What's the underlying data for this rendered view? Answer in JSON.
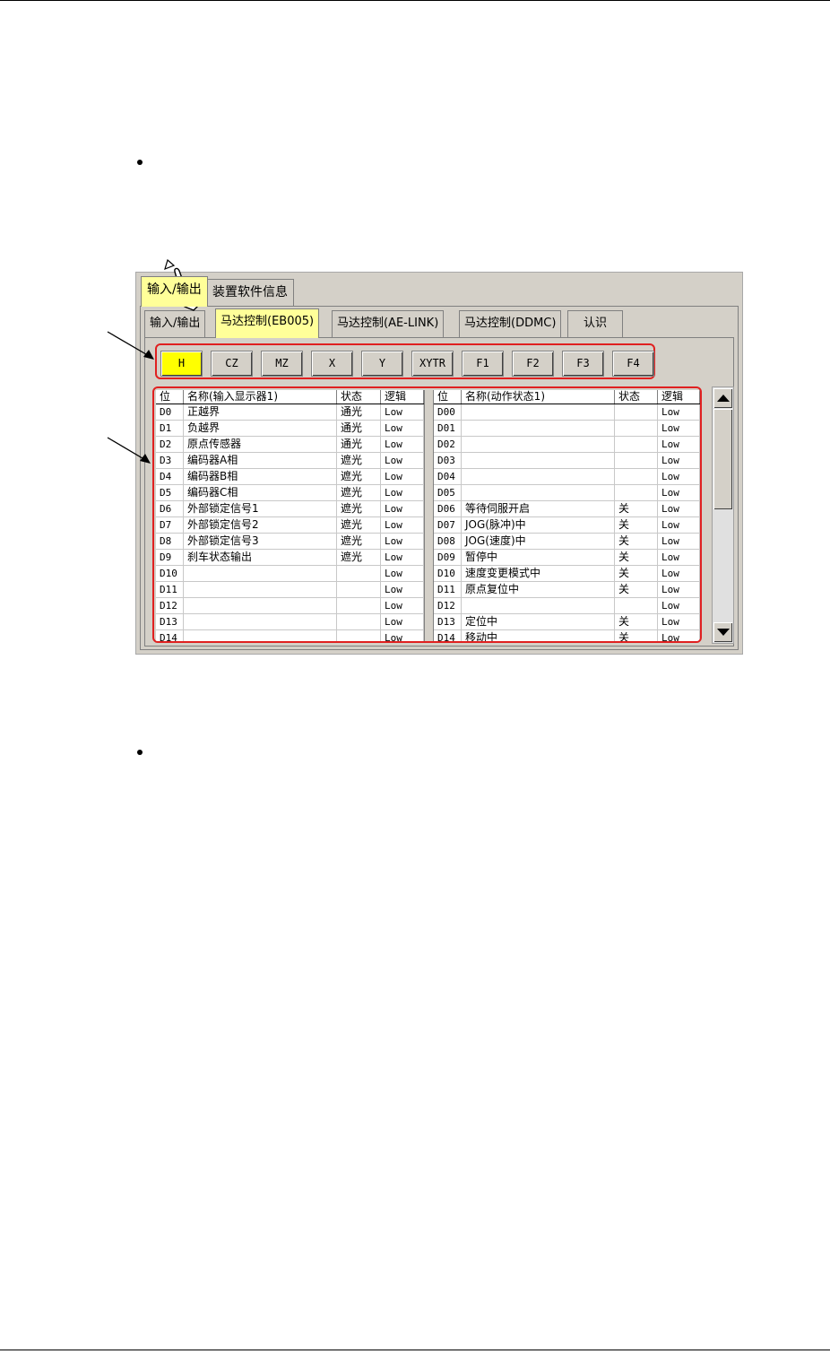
{
  "outer_tabs": [
    {
      "label": "输入/输出",
      "active": true
    },
    {
      "label": "装置软件信息",
      "active": false
    }
  ],
  "inner_tabs": [
    {
      "label": "输入/输出",
      "active": false
    },
    {
      "label": "马达控制(EB005)",
      "active": true
    },
    {
      "label": "马达控制(AE-LINK)",
      "active": false
    },
    {
      "label": "马达控制(DDMC)",
      "active": false
    },
    {
      "label": "认识",
      "active": false
    }
  ],
  "axis_buttons": [
    {
      "label": "H",
      "active": true
    },
    {
      "label": "CZ",
      "active": false
    },
    {
      "label": "MZ",
      "active": false
    },
    {
      "label": "X",
      "active": false
    },
    {
      "label": "Y",
      "active": false
    },
    {
      "label": "XYTR",
      "active": false
    },
    {
      "label": "F1",
      "active": false
    },
    {
      "label": "F2",
      "active": false
    },
    {
      "label": "F3",
      "active": false
    },
    {
      "label": "F4",
      "active": false
    }
  ],
  "left_table": {
    "headers": [
      "位",
      "名称(输入显示器1)",
      "状态",
      "逻辑"
    ],
    "rows": [
      [
        "D0",
        "正越界",
        "通光",
        "Low"
      ],
      [
        "D1",
        "负越界",
        "通光",
        "Low"
      ],
      [
        "D2",
        "原点传感器",
        "通光",
        "Low"
      ],
      [
        "D3",
        "编码器A相",
        "遮光",
        "Low"
      ],
      [
        "D4",
        "编码器B相",
        "遮光",
        "Low"
      ],
      [
        "D5",
        "编码器C相",
        "遮光",
        "Low"
      ],
      [
        "D6",
        "外部锁定信号1",
        "遮光",
        "Low"
      ],
      [
        "D7",
        "外部锁定信号2",
        "遮光",
        "Low"
      ],
      [
        "D8",
        "外部锁定信号3",
        "遮光",
        "Low"
      ],
      [
        "D9",
        "刹车状态输出",
        "遮光",
        "Low"
      ],
      [
        "D10",
        "",
        "",
        "Low"
      ],
      [
        "D11",
        "",
        "",
        "Low"
      ],
      [
        "D12",
        "",
        "",
        "Low"
      ],
      [
        "D13",
        "",
        "",
        "Low"
      ],
      [
        "D14",
        "",
        "",
        "Low"
      ]
    ]
  },
  "right_table": {
    "headers": [
      "位",
      "名称(动作状态1)",
      "状态",
      "逻辑"
    ],
    "rows": [
      [
        "D00",
        "",
        "",
        "Low"
      ],
      [
        "D01",
        "",
        "",
        "Low"
      ],
      [
        "D02",
        "",
        "",
        "Low"
      ],
      [
        "D03",
        "",
        "",
        "Low"
      ],
      [
        "D04",
        "",
        "",
        "Low"
      ],
      [
        "D05",
        "",
        "",
        "Low"
      ],
      [
        "D06",
        "等待伺服开启",
        "关",
        "Low"
      ],
      [
        "D07",
        "JOG(脉冲)中",
        "关",
        "Low"
      ],
      [
        "D08",
        "JOG(速度)中",
        "关",
        "Low"
      ],
      [
        "D09",
        "暂停中",
        "关",
        "Low"
      ],
      [
        "D10",
        "速度变更模式中",
        "关",
        "Low"
      ],
      [
        "D11",
        "原点复位中",
        "关",
        "Low"
      ],
      [
        "D12",
        "",
        "",
        "Low"
      ],
      [
        "D13",
        "定位中",
        "关",
        "Low"
      ],
      [
        "D14",
        "移动中",
        "关",
        "Low"
      ]
    ]
  },
  "icons": {
    "pointer": "hand-pointer-icon",
    "scroll_up": "triangle-up-icon",
    "scroll_down": "triangle-down-icon"
  },
  "colors": {
    "highlight_yellow": "#ffff00",
    "active_tab": "#ffff99",
    "callout_red": "#e02020",
    "panel_gray": "#d4d0c8"
  }
}
